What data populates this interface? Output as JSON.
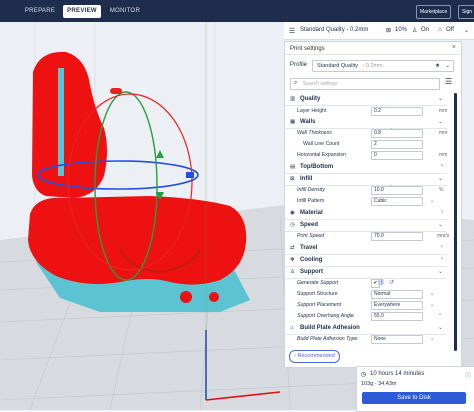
{
  "topbar": {
    "tabs": [
      {
        "label": "PREPARE"
      },
      {
        "label": "PREVIEW"
      },
      {
        "label": "MONITOR"
      }
    ],
    "marketplace_label": "Marketplace",
    "signin_label": "Sign"
  },
  "quality_bar": {
    "profile_label": "Standard Quality - 0.2mm",
    "infill_label": "10%",
    "support_label": "On",
    "adhesion_label": "Off"
  },
  "print_settings": {
    "title": "Print settings",
    "profile_label": "Profile",
    "profile_value": "Standard Quality",
    "profile_suffix": "- 0.2mm",
    "search_placeholder": "Search settings",
    "recommended_label": "Recommended",
    "categories": [
      {
        "label": "Quality"
      },
      {
        "label": "Walls"
      },
      {
        "label": "Top/Bottom"
      },
      {
        "label": "Infill"
      },
      {
        "label": "Material"
      },
      {
        "label": "Speed"
      },
      {
        "label": "Travel"
      },
      {
        "label": "Cooling"
      },
      {
        "label": "Support"
      },
      {
        "label": "Build Plate Adhesion"
      }
    ],
    "settings": {
      "layer_height": {
        "label": "Layer Height",
        "value": "0.2",
        "unit": "mm"
      },
      "wall_thickness": {
        "label": "Wall Thickness",
        "value": "0.8",
        "unit": "mm"
      },
      "wall_line_count": {
        "label": "Wall Line Count",
        "value": "2"
      },
      "horizontal_expansion": {
        "label": "Horizontal Expansion",
        "value": "0",
        "unit": "mm"
      },
      "infill_density": {
        "label": "Infill Density",
        "value": "10.0",
        "unit": "%"
      },
      "infill_pattern": {
        "label": "Infill Pattern",
        "value": "Cubic"
      },
      "print_speed": {
        "label": "Print Speed",
        "value": "70.0",
        "unit": "mm/s"
      },
      "generate_support": {
        "label": "Generate Support",
        "value": "✔"
      },
      "support_structure": {
        "label": "Support Structure",
        "value": "Normal"
      },
      "support_placement": {
        "label": "Support Placement",
        "value": "Everywhere"
      },
      "support_overhang_angle": {
        "label": "Support Overhang Angle",
        "value": "55.0",
        "unit": "°"
      },
      "build_plate_adhesion_type": {
        "label": "Build Plate Adhesion Type",
        "value": "None"
      }
    }
  },
  "estimate": {
    "time": "10 hours 14 minutes",
    "material": "103g · 34.43m",
    "save_label": "Save to Disk"
  },
  "colors": {
    "topbar": "#1f2d4d",
    "accent": "#2d5bd8",
    "model": "#ee1111",
    "support": "#5cc3d3"
  }
}
